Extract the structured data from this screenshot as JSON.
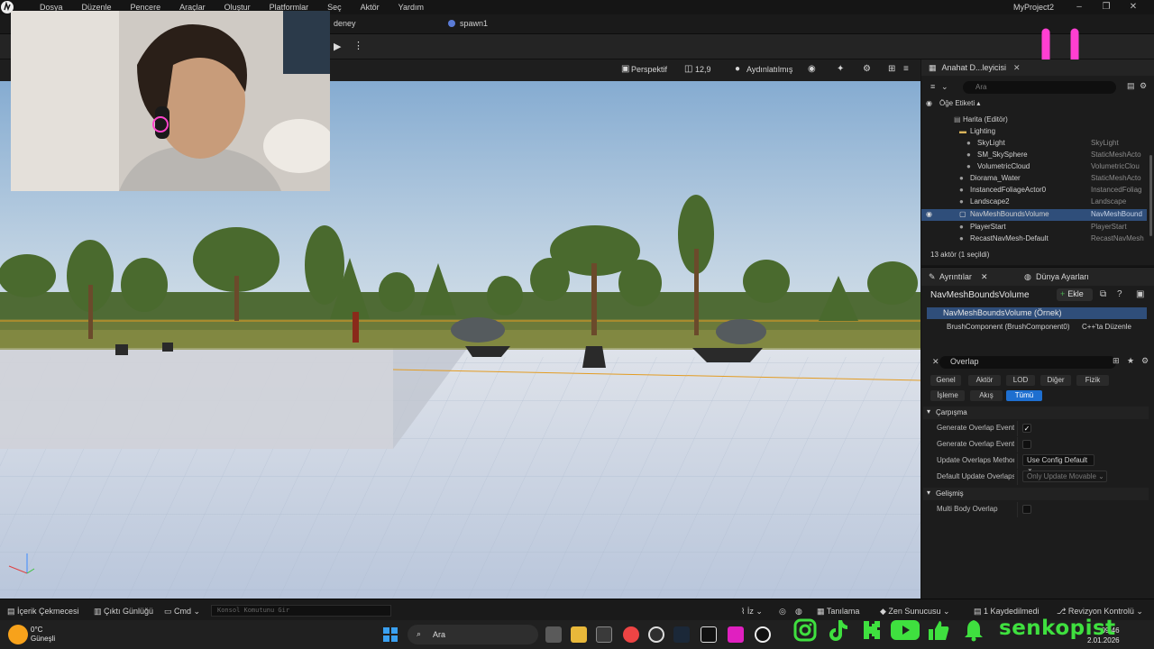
{
  "menubar": {
    "items": [
      "Dosya",
      "Düzenle",
      "Pencere",
      "Araçlar",
      "Oluştur",
      "Platformlar",
      "Seç",
      "Aktör",
      "Yardım"
    ],
    "project": "MyProject2",
    "window_controls": [
      "minimize-icon",
      "restore-icon",
      "close-icon"
    ]
  },
  "tabs": [
    "deney",
    "spawn1"
  ],
  "viewport_toolbar": {
    "view_mode": "Perspektif",
    "fov": "12,9",
    "lighting": "Aydınlatılmış"
  },
  "outliner": {
    "title": "Anahat D...leyicisi",
    "search_placeholder": "Ara",
    "column_label": "Öğe Etiketi",
    "rows": [
      {
        "name": "Harita (Editör)",
        "type": ""
      },
      {
        "name": "Lighting",
        "type": ""
      },
      {
        "name": "SkyLight",
        "type": "SkyLight"
      },
      {
        "name": "SM_SkySphere",
        "type": "StaticMeshActo"
      },
      {
        "name": "VolumetricCloud",
        "type": "VolumetricClou"
      },
      {
        "name": "Diorama_Water",
        "type": "StaticMeshActo"
      },
      {
        "name": "InstancedFoliageActor0",
        "type": "InstancedFoliag"
      },
      {
        "name": "Landscape2",
        "type": "Landscape"
      },
      {
        "name": "NavMeshBoundsVolume",
        "type": "NavMeshBound"
      },
      {
        "name": "PlayerStart",
        "type": "PlayerStart"
      },
      {
        "name": "RecastNavMesh-Default",
        "type": "RecastNavMesh"
      }
    ],
    "selected_index": 8,
    "count": "13 aktör (1 seçildi)"
  },
  "details": {
    "tabs": [
      "Ayrıntılar",
      "Dünya Ayarları"
    ],
    "actor_name": "NavMeshBoundsVolume",
    "add_label": "Ekle",
    "component_root": "NavMeshBoundsVolume (Örnek)",
    "component_child": "BrushComponent (BrushComponent0)",
    "cpp_link": "C++'ta Düzenle",
    "filter_text": "Overlap",
    "filter_buttons_row1": [
      "Genel",
      "Aktör",
      "LOD",
      "Diğer",
      "Fizik"
    ],
    "filter_buttons_row2": [
      "İşleme",
      "Akış",
      "Tümü"
    ],
    "active_filter": "Tümü",
    "section1": "Çarpışma",
    "props": [
      {
        "label": "Generate Overlap Events",
        "kind": "check",
        "value": "✓"
      },
      {
        "label": "Generate Overlap Events During Level Streaming",
        "kind": "check",
        "value": ""
      },
      {
        "label": "Update Overlaps Method During Level Streaming",
        "kind": "dropdown",
        "value": "Use Config Default"
      },
      {
        "label": "Default Update Overlaps Method During Level Streaming",
        "kind": "dropdown",
        "value": "Only Update Movable"
      }
    ],
    "section2": "Gelişmiş",
    "props2": [
      {
        "label": "Multi Body Overlap",
        "kind": "check",
        "value": ""
      }
    ]
  },
  "statusbar": {
    "content_drawer": "İçerik Çekmecesi",
    "output_log": "Çıktı Günlüğü",
    "cmd": "Cmd",
    "console_placeholder": "Konsol Komutunu Gir",
    "trace": "İz",
    "derived": "Tanılama",
    "zen": "Zen Sunucusu",
    "saved": "1 Kaydedilmedi",
    "revision": "Revizyon Kontrolü"
  },
  "taskbar": {
    "temperature": "0°C",
    "weather": "Güneşli",
    "search_placeholder": "Ara",
    "time": "09:46",
    "date": "2.01.2026"
  },
  "overlay": {
    "brand": "senkopist",
    "socials": [
      "instagram-icon",
      "tiktok-icon",
      "kick-icon",
      "youtube-icon",
      "like-icon",
      "bell-icon"
    ]
  },
  "colors": {
    "selection": "#2f4e7a",
    "accent_blue": "#1e6fd0",
    "brand_green": "#3fe03f",
    "overlay_pink": "#ff3fd2"
  }
}
